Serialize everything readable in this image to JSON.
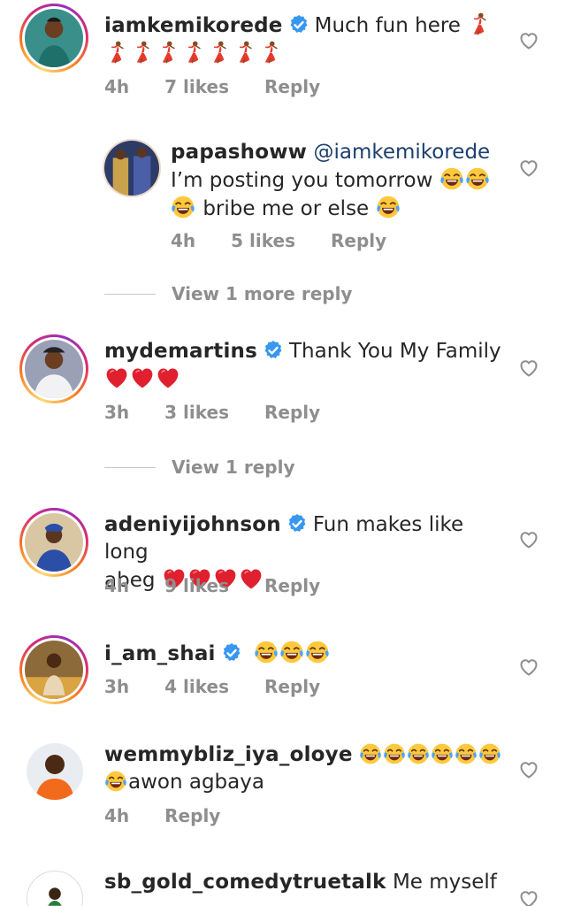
{
  "comments": [
    {
      "username": "iamkemikorede",
      "verified": true,
      "text": "Much fun here",
      "emojis": "💃💃💃💃💃💃💃💃",
      "time": "4h",
      "likes": "7 likes",
      "reply": "Reply"
    },
    {
      "username": "papashoww",
      "mention": "@iamkemikorede",
      "text_line1": "I’m posting you tomorrow",
      "text_line2": "bribe me or else",
      "time": "4h",
      "likes": "5 likes",
      "reply": "Reply",
      "view_more": "View 1 more reply"
    },
    {
      "username": "mydemartins",
      "verified": true,
      "text": "Thank You My Family",
      "time": "3h",
      "likes": "3 likes",
      "reply": "Reply",
      "view_more": "View 1 reply"
    },
    {
      "username": "adeniyijohnson",
      "verified": true,
      "text": "Fun makes like long",
      "text_line2": "abeg",
      "time": "4h",
      "likes": "9 likes",
      "reply": "Reply"
    },
    {
      "username": "i_am_shai",
      "verified": true,
      "time": "3h",
      "likes": "4 likes",
      "reply": "Reply"
    },
    {
      "username": "wemmybliz_iya_oloye",
      "text_line2": "awon agbaya",
      "time": "4h",
      "reply": "Reply"
    },
    {
      "username": "sb_gold_comedytruetalk",
      "text": "Me myself"
    }
  ],
  "colors": {
    "heart_red": "#e0202e",
    "verified_blue": "#3897f0",
    "meta_gray": "#8e8e8e"
  },
  "icons": {
    "like": "heart-outline-icon",
    "verified": "verified-badge-icon",
    "laugh": "tears-of-joy-emoji",
    "dancer": "dancer-emoji",
    "heart": "red-heart-emoji"
  }
}
